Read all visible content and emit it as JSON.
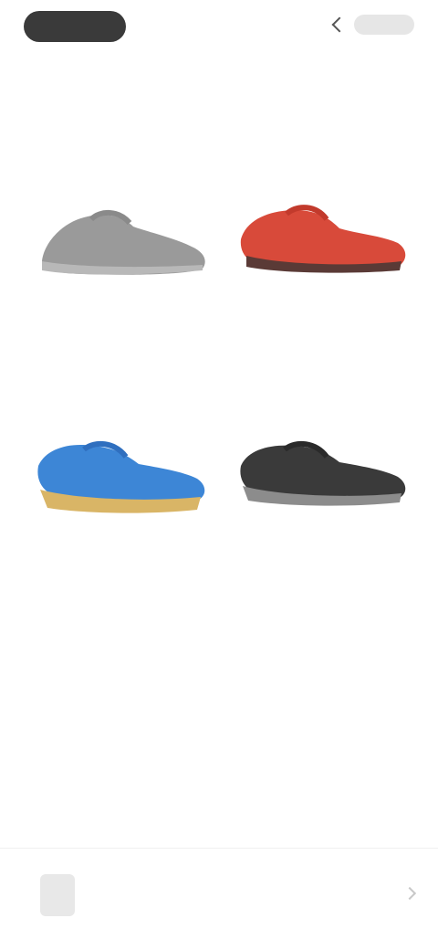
{
  "header": {
    "logo_icon": "brand-logo-icon",
    "back_icon": "chevron-left-icon",
    "action_label": ""
  },
  "section": {
    "title": ""
  },
  "products": [
    {
      "name": "",
      "subtitle": "",
      "price": "",
      "color": "#9a9a9a",
      "icon": "shoe-grey-icon"
    },
    {
      "name": "",
      "subtitle": "",
      "price": "",
      "color": "#d84a3a",
      "icon": "shoe-red-icon"
    },
    {
      "name": "",
      "subtitle": "",
      "price": "",
      "color": "#3d86d6",
      "icon": "shoe-blue-icon"
    },
    {
      "name": "",
      "subtitle": "",
      "price": "",
      "color": "#3a3a3a",
      "icon": "shoe-black-icon"
    }
  ],
  "bottom_bar": {
    "label": "",
    "thumbnail_icon": "product-thumbnail-icon",
    "arrow_icon": "chevron-right-icon"
  }
}
